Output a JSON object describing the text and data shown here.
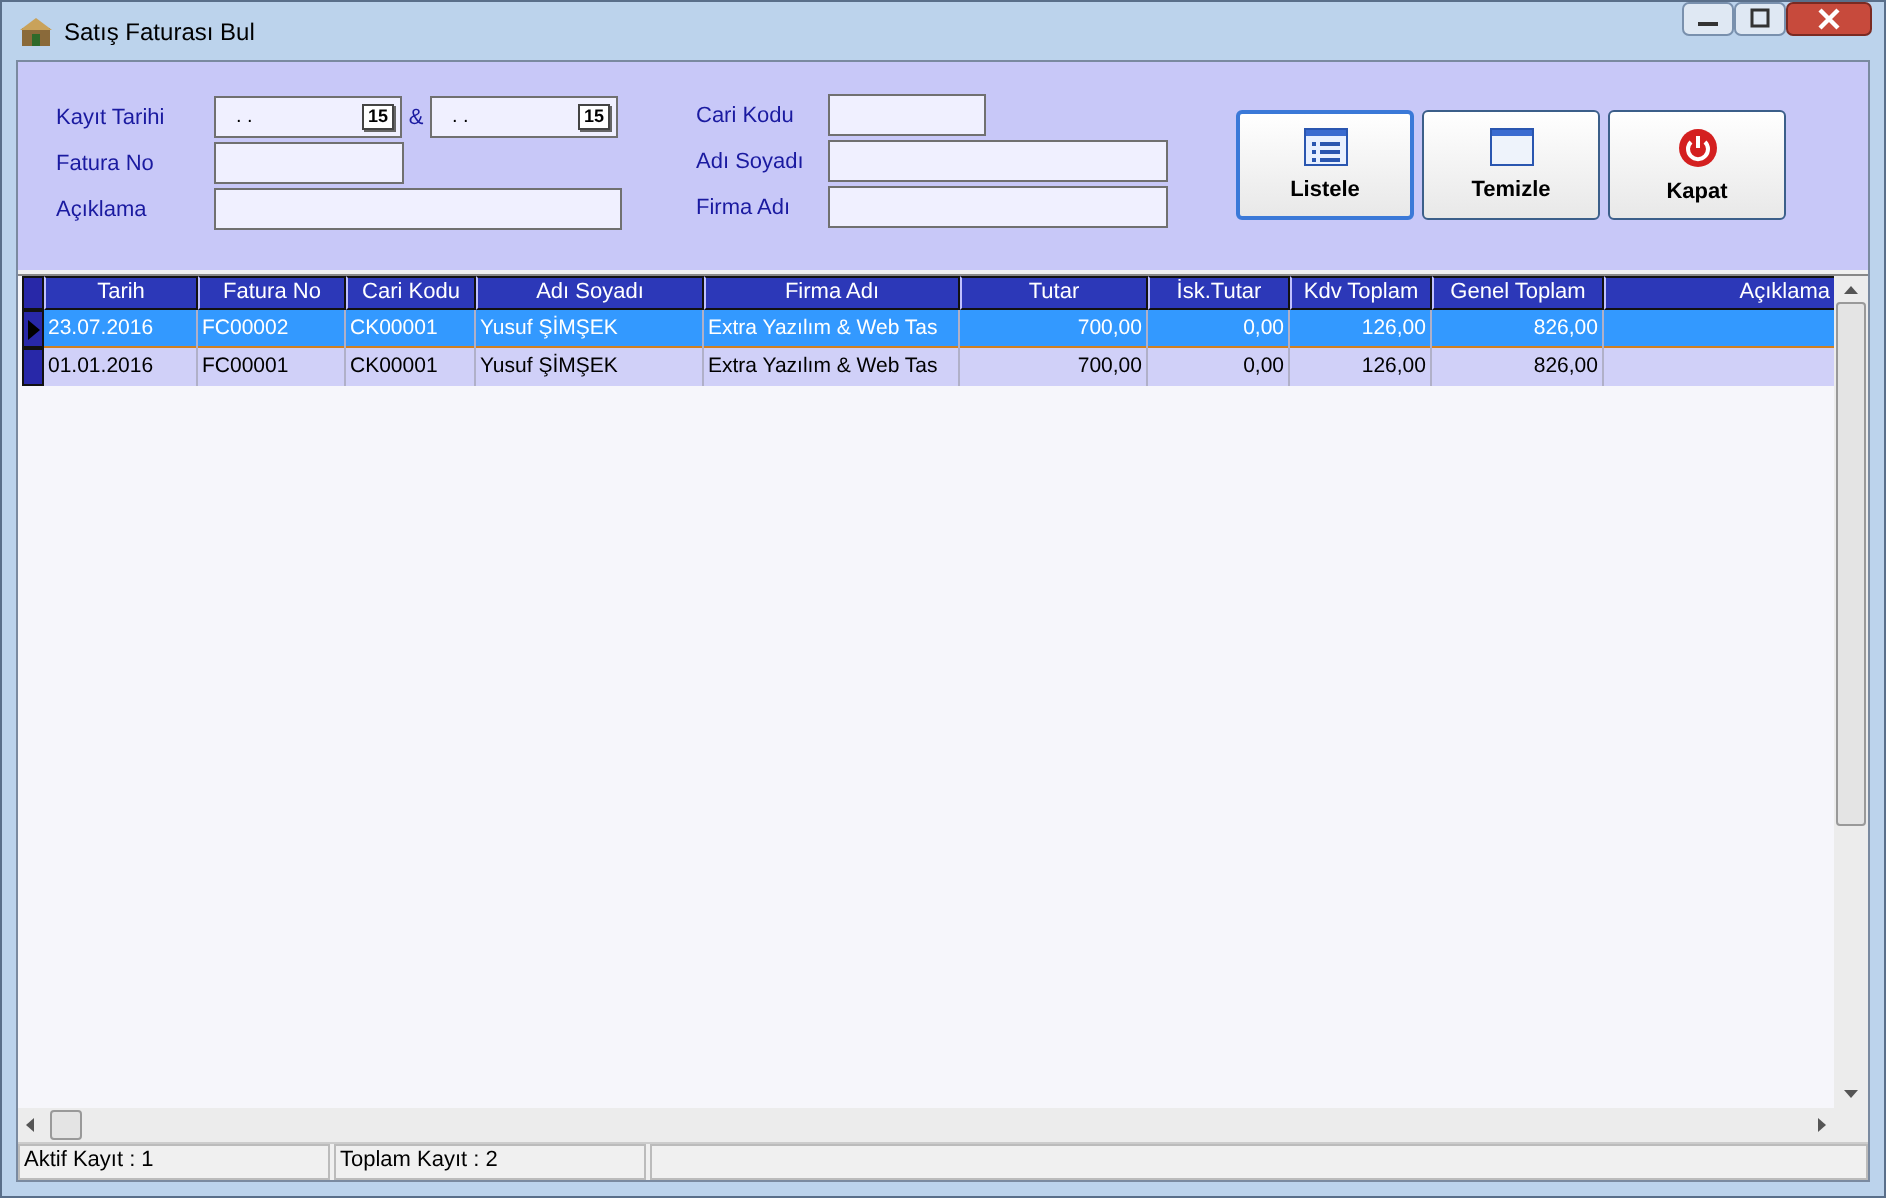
{
  "window": {
    "title": "Satış Faturası Bul"
  },
  "filters": {
    "left": [
      {
        "label": "Kayıt Tarihi",
        "kind": "daterange",
        "from": ". .",
        "to": ". .",
        "separator": "&",
        "from_calendar": "15",
        "to_calendar": "15"
      },
      {
        "label": "Fatura No",
        "kind": "short"
      },
      {
        "label": "Açıklama",
        "kind": "long"
      }
    ],
    "right": [
      {
        "label": "Cari Kodu",
        "kind": "short"
      },
      {
        "label": "Adı Soyadı",
        "kind": "long"
      },
      {
        "label": "Firma Adı",
        "kind": "long"
      }
    ]
  },
  "buttons": [
    {
      "label": "Listele",
      "kind": "list",
      "selected": true
    },
    {
      "label": "Temizle",
      "kind": "window",
      "selected": false
    },
    {
      "label": "Kapat",
      "kind": "power",
      "selected": false
    }
  ],
  "table": {
    "columns": [
      {
        "label": "Tarih",
        "kind": "text"
      },
      {
        "label": "Fatura No",
        "kind": "text"
      },
      {
        "label": "Cari Kodu",
        "kind": "text"
      },
      {
        "label": "Adı Soyadı",
        "kind": "text"
      },
      {
        "label": "Firma Adı",
        "kind": "text"
      },
      {
        "label": "Tutar",
        "kind": "number"
      },
      {
        "label": "İsk.Tutar",
        "kind": "number"
      },
      {
        "label": "Kdv Toplam",
        "kind": "number"
      },
      {
        "label": "Genel Toplam",
        "kind": "number"
      },
      {
        "label": "Açıklama",
        "kind": "number"
      }
    ],
    "rows": [
      {
        "selected": true,
        "cells": [
          "23.07.2016",
          "FC00002",
          "CK00001",
          "Yusuf ŞİMŞEK",
          "Extra Yazılım & Web Tas",
          "700,00",
          "0,00",
          "126,00",
          "826,00",
          ""
        ]
      },
      {
        "selected": false,
        "cells": [
          "01.01.2016",
          "FC00001",
          "CK00001",
          "Yusuf ŞİMŞEK",
          "Extra Yazılım & Web Tas",
          "700,00",
          "0,00",
          "126,00",
          "826,00",
          ""
        ]
      }
    ]
  },
  "status_bar": [
    "Aktif Kayıt : 1",
    "Toplam Kayıt : 2"
  ]
}
